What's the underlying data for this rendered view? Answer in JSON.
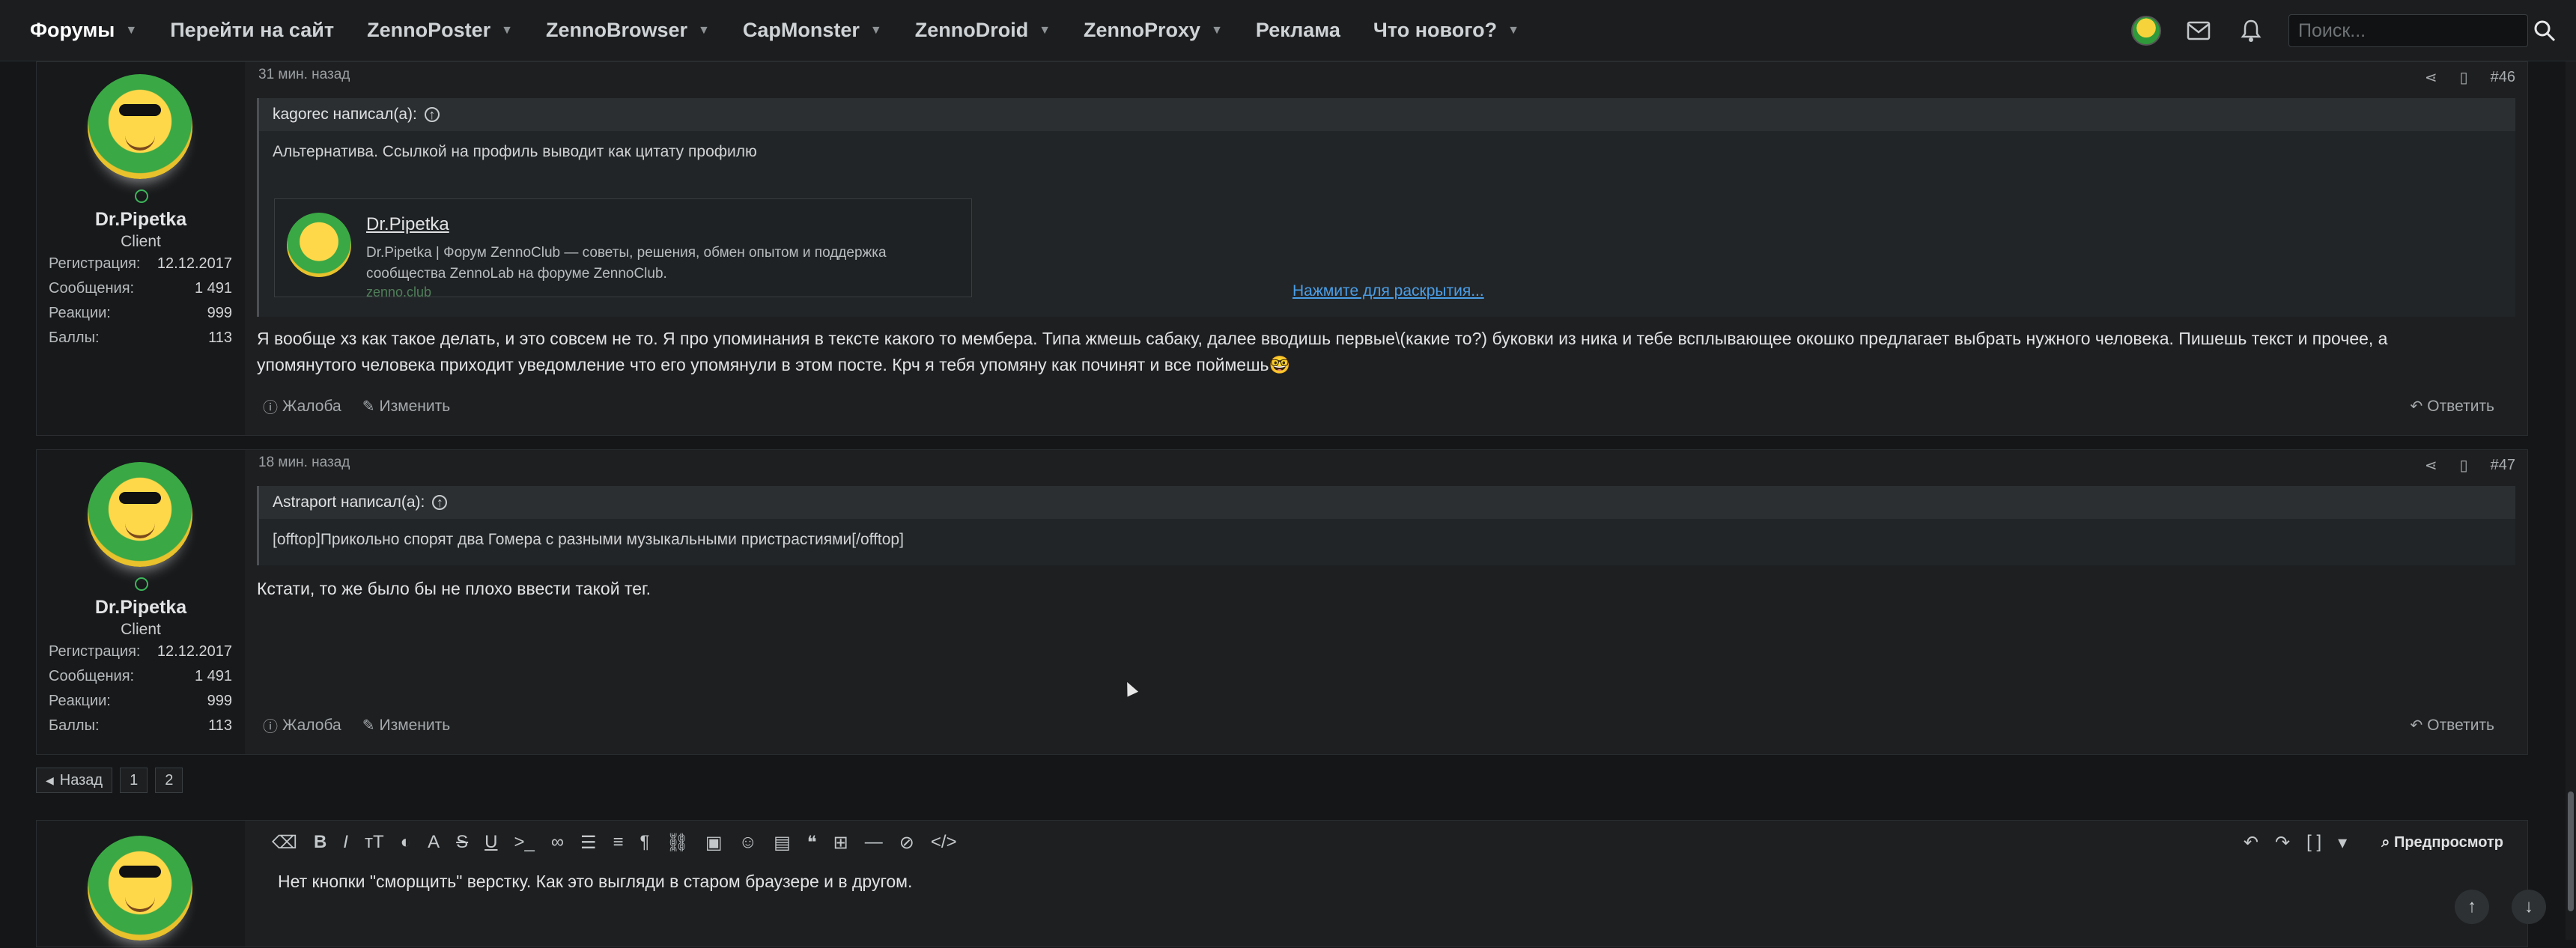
{
  "nav": {
    "items": [
      {
        "label": "Форумы",
        "dropdown": true
      },
      {
        "label": "Перейти на сайт",
        "dropdown": false
      },
      {
        "label": "ZennoPoster",
        "dropdown": true
      },
      {
        "label": "ZennoBrowser",
        "dropdown": true
      },
      {
        "label": "CapMonster",
        "dropdown": true
      },
      {
        "label": "ZennoDroid",
        "dropdown": true
      },
      {
        "label": "ZennoProxy",
        "dropdown": true
      },
      {
        "label": "Реклама",
        "dropdown": false
      },
      {
        "label": "Что нового?",
        "dropdown": true
      }
    ],
    "search_placeholder": "Поиск..."
  },
  "posts": [
    {
      "time": "31 мин. назад",
      "number": "#46",
      "user": {
        "name": "Dr.Pipetka",
        "title": "Client",
        "stats": [
          {
            "label": "Регистрация:",
            "value": "12.12.2017"
          },
          {
            "label": "Сообщения:",
            "value": "1 491"
          },
          {
            "label": "Реакции:",
            "value": "999"
          },
          {
            "label": "Баллы:",
            "value": "113"
          }
        ]
      },
      "quote_author": "kagorec написал(а):",
      "quote_text": "Альтернатива. Ссылкой на профиль выводит как цитату профилю",
      "embed": {
        "title": "Dr.Pipetka",
        "desc": "Dr.Pipetka | Форум ZennoClub — советы, решения, обмен опытом и поддержка сообщества ZennoLab на форуме ZennoClub.",
        "domain": "zenno.club"
      },
      "expand_label": "Нажмите для раскрытия...",
      "text": "Я вообще хз как такое делать, и это совсем не то. Я про упоминания в тексте какого то мембера. Типа жмешь сабаку, далее вводишь первые\\(какие то?) буковки из ника и тебе всплывающее окошко предлагает выбрать нужного человека. Пишешь текст и прочее, а упомянутого человека приходит уведомление что его упомянули в этом посте. Крч я тебя упомяну как починят и все поймешь🤓",
      "report_label": "Жалоба",
      "edit_label": "Изменить",
      "reply_label": "Ответить"
    },
    {
      "time": "18 мин. назад",
      "number": "#47",
      "user": {
        "name": "Dr.Pipetka",
        "title": "Client",
        "stats": [
          {
            "label": "Регистрация:",
            "value": "12.12.2017"
          },
          {
            "label": "Сообщения:",
            "value": "1 491"
          },
          {
            "label": "Реакции:",
            "value": "999"
          },
          {
            "label": "Баллы:",
            "value": "113"
          }
        ]
      },
      "quote_author": "Astraport написал(а):",
      "quote_text": "[offtop]Прикольно спорят два Гомера с разными музыкальными пристрастиями[/offtop]",
      "text": "Кстати, то же было бы не плохо ввести такой тег.",
      "report_label": "Жалоба",
      "edit_label": "Изменить",
      "reply_label": "Ответить"
    }
  ],
  "pager": {
    "back_label": "Назад",
    "pages": [
      "1",
      "2"
    ]
  },
  "editor": {
    "preview_label": "Предпросмотр",
    "text": "Нет кнопки \"сморщить\" верстку. Как это выгляди в старом браузере и в другом."
  }
}
